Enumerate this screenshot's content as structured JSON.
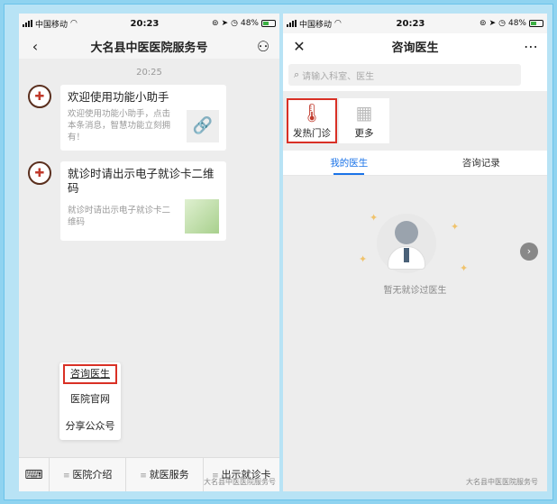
{
  "left": {
    "status": {
      "carrier": "中国移动",
      "time": "20:23",
      "battery": "48%"
    },
    "nav": {
      "title": "大名县中医医院服务号",
      "back_icon": "back-icon",
      "profile_icon": "person-icon"
    },
    "chat_time": "20:25",
    "messages": [
      {
        "title": "欢迎使用功能小助手",
        "desc": "欢迎使用功能小助手，点击本条消息，智慧功能立刻拥有！"
      },
      {
        "title": "就诊时请出示电子就诊卡二维码",
        "desc": "就诊时请出示电子就诊卡二维码"
      }
    ],
    "menu": [
      "咨询医生",
      "医院官网",
      "分享公众号"
    ],
    "bottom": [
      "医院介绍",
      "就医服务",
      "出示就诊卡"
    ],
    "watermark": "大名县中医医院服务号"
  },
  "right": {
    "status": {
      "carrier": "中国移动",
      "time": "20:23",
      "battery": "48%"
    },
    "nav": {
      "title": "咨询医生",
      "close_icon": "close-icon",
      "more_icon": "more-icon"
    },
    "search": {
      "placeholder": "请输入科室、医生"
    },
    "tiles": [
      {
        "label": "发热门诊",
        "icon": "thermometer-icon"
      },
      {
        "label": "更多",
        "icon": "grid-icon"
      }
    ],
    "tabs": [
      "我的医生",
      "咨询记录"
    ],
    "empty_text": "暂无就诊过医生",
    "watermark": "大名县中医医院服务号"
  }
}
